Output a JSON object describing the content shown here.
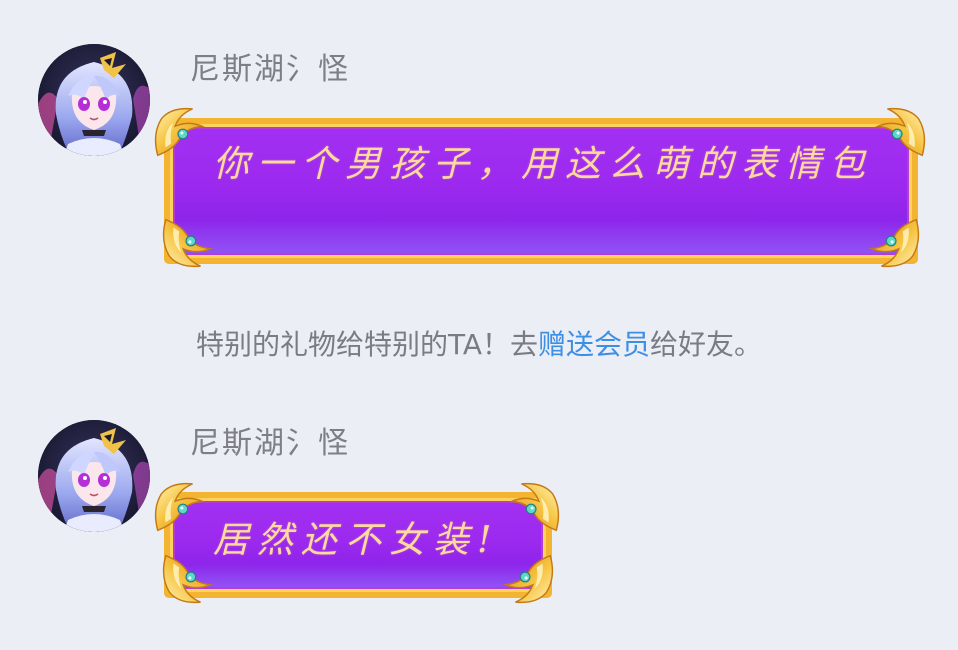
{
  "messages": [
    {
      "sender": "尼斯湖氵怪",
      "avatar_icon": "anime-avatar-icon",
      "text": "你一个男孩子，用这么萌的表情包"
    },
    {
      "sender": "尼斯湖氵怪",
      "avatar_icon": "anime-avatar-icon",
      "text": "居然还不女装!"
    }
  ],
  "notice": {
    "prefix": "特别的礼物给特别的TA！去",
    "link": "赠送会员",
    "suffix": "给好友。"
  },
  "colors": {
    "background": "#ebeef4",
    "bubble_purple": "#9c29ee",
    "bubble_gold": "#f3b431",
    "bubble_text": "#ffd9a0",
    "link": "#3d8fe6",
    "name": "#7d7f86"
  }
}
